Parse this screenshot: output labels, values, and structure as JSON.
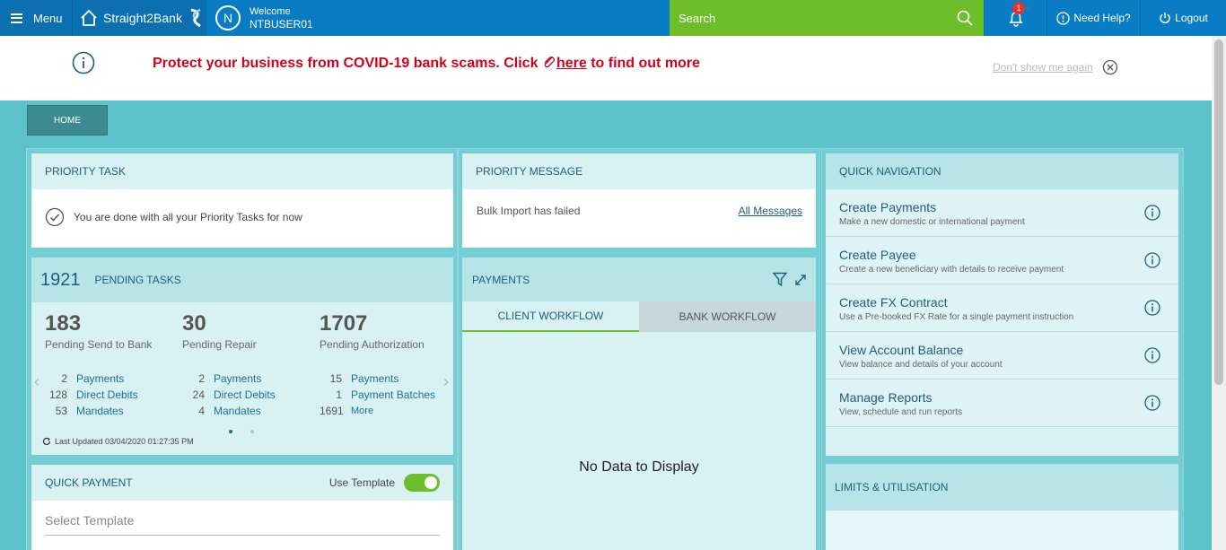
{
  "topbar": {
    "menu_label": "Menu",
    "brand": "Straight2Bank",
    "avatar_letter": "N",
    "welcome": "Welcome",
    "username": "NTBUSER01",
    "search_placeholder": "Search",
    "notification_count": "1",
    "help_label": "Need Help?",
    "logout_label": "Logout"
  },
  "banner": {
    "message_prefix": "Protect your business from COVID-19 bank scams. Click",
    "link": "here",
    "message_suffix": "to find out more",
    "dont_show": "Don't show me again"
  },
  "home_tab": "HOME",
  "priority_task": {
    "title": "PRIORITY TASK",
    "message": "You are done with all your Priority Tasks for now"
  },
  "priority_message": {
    "title": "PRIORITY MESSAGE",
    "message": "Bulk Import has failed",
    "link": "All Messages"
  },
  "pending": {
    "count": "1921",
    "title": "PENDING TASKS",
    "columns": [
      {
        "number": "183",
        "label": "Pending Send to Bank",
        "lines": [
          {
            "c": "2",
            "l": "Payments"
          },
          {
            "c": "128",
            "l": "Direct Debits"
          },
          {
            "c": "53",
            "l": "Mandates"
          }
        ]
      },
      {
        "number": "30",
        "label": "Pending Repair",
        "lines": [
          {
            "c": "2",
            "l": "Payments"
          },
          {
            "c": "24",
            "l": "Direct Debits"
          },
          {
            "c": "4",
            "l": "Mandates"
          }
        ]
      },
      {
        "number": "1707",
        "label": "Pending Authorization",
        "lines": [
          {
            "c": "15",
            "l": "Payments"
          },
          {
            "c": "1",
            "l": "Payment Batches"
          },
          {
            "c": "1691",
            "l": "More"
          }
        ]
      }
    ],
    "last_updated": "Last Updated 03/04/2020 01:27:35 PM"
  },
  "quick_payment": {
    "title": "QUICK PAYMENT",
    "toggle_label": "Use Template",
    "placeholder": "Select Template"
  },
  "payments": {
    "title": "PAYMENTS",
    "tabs": [
      "CLIENT WORKFLOW",
      "BANK WORKFLOW"
    ],
    "empty": "No Data to Display"
  },
  "quick_nav": {
    "title": "QUICK NAVIGATION",
    "items": [
      {
        "title": "Create Payments",
        "desc": "Make a new domestic or international payment"
      },
      {
        "title": "Create Payee",
        "desc": "Create a new beneficiary with details to receive payment"
      },
      {
        "title": "Create FX Contract",
        "desc": "Use a Pre-booked FX Rate for a single payment instruction"
      },
      {
        "title": "View Account Balance",
        "desc": "View balance and details of your account"
      },
      {
        "title": "Manage Reports",
        "desc": "View, schedule and run reports"
      }
    ]
  },
  "limits": {
    "title": "LIMITS & UTILISATION"
  },
  "colors": {
    "topbar": "#0a7cc4",
    "search": "#6ebd2a",
    "background": "#5bc2c9",
    "alert": "#d0021b"
  }
}
